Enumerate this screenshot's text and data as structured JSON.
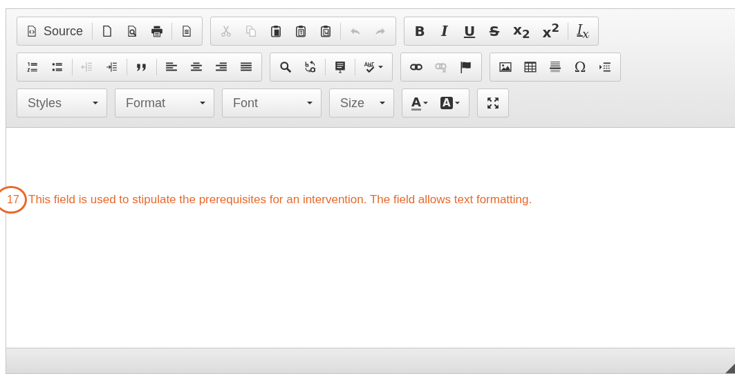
{
  "toolbar": {
    "rows": [
      {
        "groups": [
          {
            "buttons": [
              {
                "kind": "label",
                "text": "Source",
                "disabled": false
              },
              {
                "kind": "separator"
              },
              {
                "kind": "icon",
                "disabled": false
              },
              {
                "kind": "icon",
                "disabled": false
              },
              {
                "kind": "icon",
                "disabled": false
              },
              {
                "kind": "separator"
              },
              {
                "kind": "icon",
                "disabled": false
              }
            ]
          },
          {
            "buttons": [
              {
                "kind": "icon",
                "disabled": true
              },
              {
                "kind": "icon",
                "disabled": true
              },
              {
                "kind": "icon",
                "disabled": false
              },
              {
                "kind": "icon",
                "disabled": false
              },
              {
                "kind": "icon",
                "disabled": false
              },
              {
                "kind": "separator"
              },
              {
                "kind": "icon",
                "disabled": true
              },
              {
                "kind": "icon",
                "disabled": true
              }
            ]
          },
          {
            "buttons": [
              {
                "kind": "glyph",
                "text": "B",
                "disabled": false
              },
              {
                "kind": "glyph",
                "text": "I",
                "disabled": false
              },
              {
                "kind": "glyph",
                "text": "U",
                "disabled": false
              },
              {
                "kind": "glyph",
                "text": "S",
                "disabled": false
              },
              {
                "kind": "glyph",
                "text": "x$_{2}$",
                "disabled": false
              },
              {
                "kind": "glyph",
                "text": "x$^{2}$",
                "disabled": false
              },
              {
                "kind": "separator"
              },
              {
                "kind": "glyph",
                "text": "I$_{x}$",
                "disabled": false
              }
            ]
          }
        ]
      },
      {
        "groups": [
          {
            "buttons": [
              {
                "kind": "icon",
                "disabled": false
              },
              {
                "kind": "icon",
                "disabled": false
              },
              {
                "kind": "separator"
              },
              {
                "kind": "icon",
                "disabled": true
              },
              {
                "kind": "icon",
                "disabled": false
              },
              {
                "kind": "separator"
              },
              {
                "kind": "icon",
                "disabled": false
              },
              {
                "kind": "separator"
              },
              {
                "kind": "icon",
                "disabled": false
              },
              {
                "kind": "icon",
                "disabled": false
              },
              {
                "kind": "icon",
                "disabled": false
              },
              {
                "kind": "icon",
                "disabled": false
              }
            ]
          },
          {
            "buttons": [
              {
                "kind": "icon",
                "disabled": false
              },
              {
                "kind": "icon",
                "disabled": false
              },
              {
                "kind": "separator"
              },
              {
                "kind": "icon",
                "disabled": false
              },
              {
                "kind": "separator"
              },
              {
                "kind": "icon",
                "disabled": false,
                "menu": true
              }
            ]
          },
          {
            "buttons": [
              {
                "kind": "icon",
                "disabled": false
              },
              {
                "kind": "icon",
                "disabled": true
              },
              {
                "kind": "icon",
                "disabled": false
              }
            ]
          },
          {
            "buttons": [
              {
                "kind": "icon",
                "disabled": false
              },
              {
                "kind": "icon",
                "disabled": false
              },
              {
                "kind": "icon",
                "disabled": false
              },
              {
                "kind": "glyph",
                "text": "Ω",
                "disabled": false
              },
              {
                "kind": "icon",
                "disabled": false
              }
            ]
          }
        ]
      },
      {
        "groups": [
          {
            "kind": "dropdown",
            "text": "Styles"
          },
          {
            "kind": "dropdown",
            "text": "Format"
          },
          {
            "kind": "dropdown",
            "text": "Font"
          },
          {
            "kind": "dropdown",
            "text": "Size"
          },
          {
            "buttons": [
              {
                "kind": "color",
                "text": "A",
                "disabled": false,
                "menu": true
              },
              {
                "kind": "color",
                "text": "A",
                "disabled": false,
                "menu": true
              }
            ]
          },
          {
            "buttons": [
              {
                "kind": "icon",
                "disabled": false
              }
            ]
          }
        ]
      }
    ]
  },
  "annotation": {
    "number": "17",
    "text": "This field is used to stipulate the prerequisites for an intervention. The field allows text formatting."
  }
}
